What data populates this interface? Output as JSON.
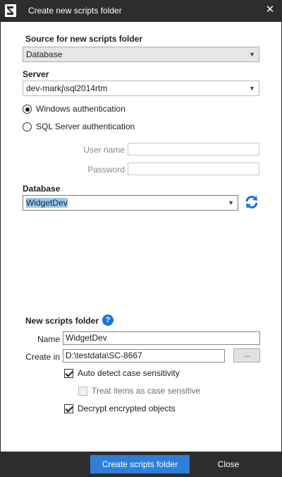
{
  "window": {
    "title": "Create new scripts folder"
  },
  "source": {
    "heading": "Source for new scripts folder",
    "selected": "Database"
  },
  "server": {
    "heading": "Server",
    "value": "dev-markj\\sql2014rtm"
  },
  "auth": {
    "windows_label": "Windows authentication",
    "sql_label": "SQL Server authentication",
    "selected": "windows",
    "username_label": "User name",
    "password_label": "Password",
    "username_value": "",
    "password_value": ""
  },
  "database": {
    "heading": "Database",
    "selected": "WidgetDev"
  },
  "scripts_folder": {
    "heading": "New scripts folder",
    "name_label": "Name",
    "name_value": "WidgetDev",
    "create_in_label": "Create in",
    "create_in_value": "D:\\testdata\\SC-8667",
    "browse_label": "...",
    "auto_detect_label": "Auto detect case sensitivity",
    "auto_detect_checked": true,
    "treat_case_label": "Treat items as case sensitive",
    "treat_case_checked": false,
    "decrypt_label": "Decrypt encrypted objects",
    "decrypt_checked": true
  },
  "footer": {
    "create_button": "Create scripts folder",
    "close_button": "Close"
  },
  "colors": {
    "titlebar": "#2d2d30",
    "accent": "#2f7fd8",
    "selection": "#99c9ef",
    "help": "#1e73d6"
  }
}
